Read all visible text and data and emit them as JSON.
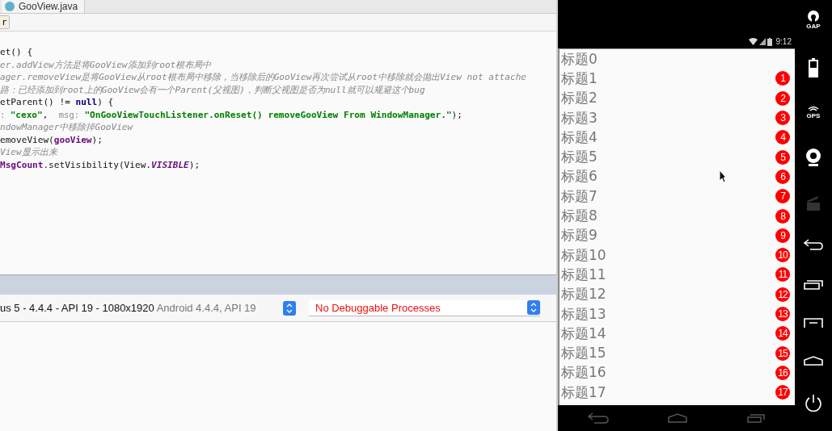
{
  "editor": {
    "tab": {
      "label": "GooView.java"
    },
    "toolbar_button": "r",
    "code_lines": [
      [
        {
          "kind": "plain",
          "text": "et() {"
        }
      ],
      [
        {
          "kind": "comment",
          "text": "er.addView方法是将GooView添加到root根布局中"
        }
      ],
      [
        {
          "kind": "comment",
          "text": "ager.removeView是将GooView从root根布局中移除，当移除后的GooView再次尝试从root中移除就会抛出View not attache"
        }
      ],
      [
        {
          "kind": "comment",
          "text": "路：已经添加到root上的GooView会有一个Parent(父视图)，判断父视图是否为null就可以规避这个bug"
        }
      ],
      [
        {
          "kind": "plain",
          "text": "etParent() != "
        },
        {
          "kind": "keyword",
          "text": "null"
        },
        {
          "kind": "plain",
          "text": ") {"
        }
      ],
      [
        {
          "kind": "hint",
          "text": ": "
        },
        {
          "kind": "string",
          "text": "\"cexo\""
        },
        {
          "kind": "plain",
          "text": ",  "
        },
        {
          "kind": "hint",
          "text": "msg: "
        },
        {
          "kind": "string",
          "text": "\"OnGooViewTouchListener.onReset() removeGooView From WindowManager.\""
        },
        {
          "kind": "plain",
          "text": ");"
        }
      ],
      [
        {
          "kind": "comment",
          "text": "ndowManager中移除掉GooView"
        }
      ],
      [
        {
          "kind": "plain",
          "text": "emoveView("
        },
        {
          "kind": "field",
          "text": "gooView"
        },
        {
          "kind": "plain",
          "text": ");"
        }
      ],
      [
        {
          "kind": "comment",
          "text": "View显示出来"
        }
      ],
      [
        {
          "kind": "field",
          "text": "MsgCount"
        },
        {
          "kind": "plain",
          "text": ".setVisibility(View."
        },
        {
          "kind": "constant",
          "text": "VISIBLE"
        },
        {
          "kind": "plain",
          "text": ");"
        }
      ]
    ]
  },
  "device_bar": {
    "device": {
      "name": "us 5 - 4.4.4 - API 19 - 1080x1920",
      "detail": "Android 4.4.4, API 19"
    },
    "process": {
      "label": "No Debuggable Processes"
    }
  },
  "phone": {
    "status_bar": {
      "time": "9:12"
    },
    "list": [
      {
        "title": "标题0"
      },
      {
        "title": "标题1",
        "badge": "1"
      },
      {
        "title": "标题2",
        "badge": "2"
      },
      {
        "title": "标题3",
        "badge": "3"
      },
      {
        "title": "标题4",
        "badge": "4"
      },
      {
        "title": "标题5",
        "badge": "5"
      },
      {
        "title": "标题6",
        "badge": "6"
      },
      {
        "title": "标题7",
        "badge": "7"
      },
      {
        "title": "标题8",
        "badge": "8"
      },
      {
        "title": "标题9",
        "badge": "9"
      },
      {
        "title": "标题10",
        "badge": "10"
      },
      {
        "title": "标题11",
        "badge": "11"
      },
      {
        "title": "标题12",
        "badge": "12"
      },
      {
        "title": "标题13",
        "badge": "13"
      },
      {
        "title": "标题14",
        "badge": "14"
      },
      {
        "title": "标题15",
        "badge": "15"
      },
      {
        "title": "标题16",
        "badge": "16"
      },
      {
        "title": "标题17",
        "badge": "17"
      }
    ]
  },
  "emulator_toolbar": {
    "gapps_label": "GAP",
    "gps_label": "GPS"
  }
}
